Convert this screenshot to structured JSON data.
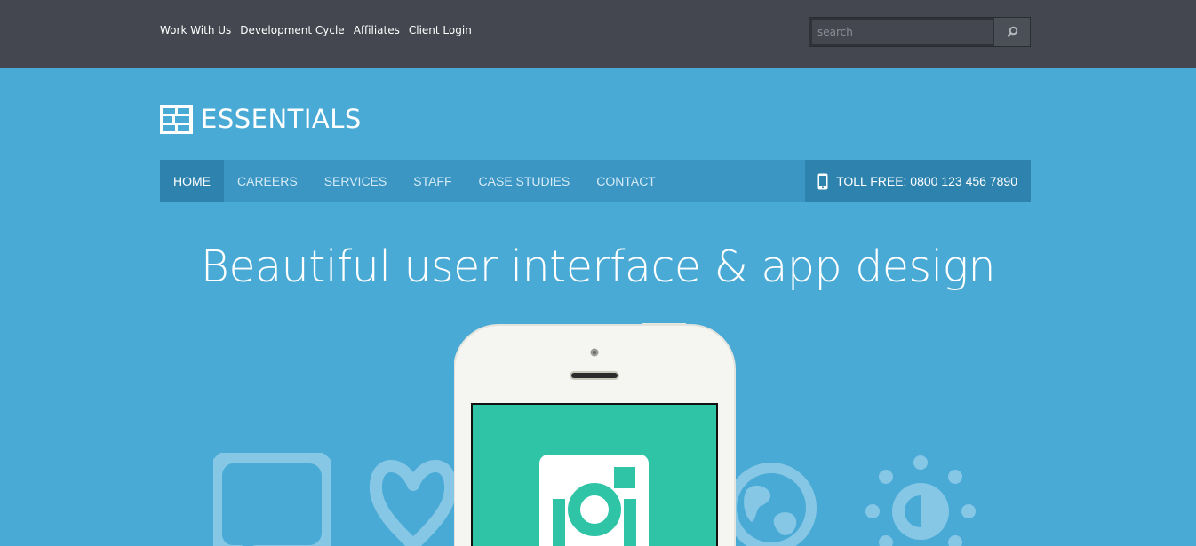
{
  "topbar": {
    "links": [
      "Work With Us",
      "Development Cycle",
      "Affiliates",
      "Client Login"
    ],
    "search_placeholder": "search"
  },
  "logo": {
    "text": "ESSENTIALS"
  },
  "nav": {
    "items": [
      "HOME",
      "CAREERS",
      "SERVICES",
      "STAFF",
      "CASE STUDIES",
      "CONTACT"
    ],
    "active": "HOME",
    "toll_free": "TOLL FREE: 0800 123 456 7890"
  },
  "hero": {
    "headline": "Beautiful user interface & app design"
  },
  "icons": [
    "speech-bubble-icon",
    "heart-icon",
    "globe-icon",
    "sun-icon",
    "phone-icon",
    "camera-app-icon",
    "search-icon"
  ],
  "colors": {
    "topbar": "#44474f",
    "hero": "#4aaad6",
    "nav": "#3b96c4",
    "nav_active": "#2e83ae",
    "screen": "#2ec4a5"
  }
}
